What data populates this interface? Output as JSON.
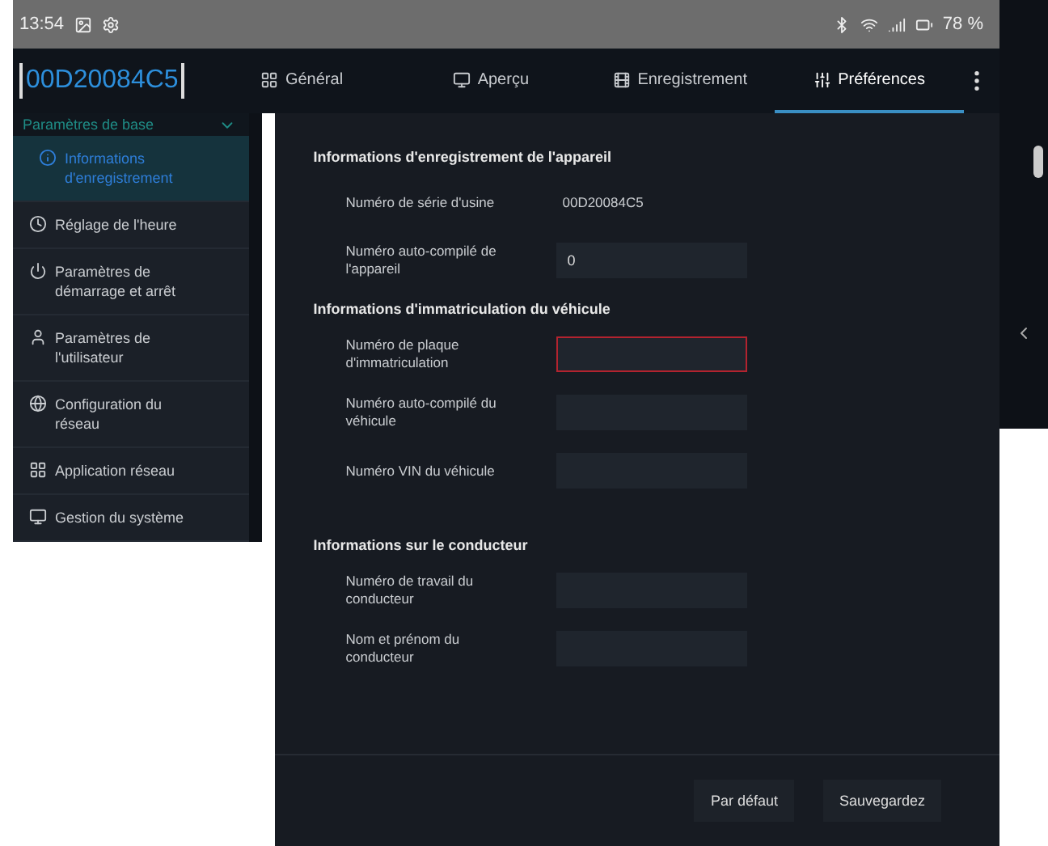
{
  "status_bar": {
    "time": "13:54",
    "battery": "78 %"
  },
  "header": {
    "device_id": "00D20084C5",
    "tabs": [
      {
        "label": "Général",
        "selected": false
      },
      {
        "label": "Aperçu",
        "selected": false
      },
      {
        "label": "Enregistrement",
        "selected": false
      },
      {
        "label": "Préférences",
        "selected": true
      }
    ]
  },
  "sidebar": {
    "group": "Paramètres de base",
    "expanded": true,
    "items": [
      {
        "label": "Informations d'enregistrement",
        "selected": true
      },
      {
        "label": "Réglage de l'heure",
        "selected": false
      },
      {
        "label": "Paramètres de démarrage et arrêt",
        "selected": false
      },
      {
        "label": "Paramètres de l'utilisateur",
        "selected": false
      },
      {
        "label": "Configuration du réseau",
        "selected": false
      },
      {
        "label": "Application réseau",
        "selected": false
      },
      {
        "label": "Gestion du système",
        "selected": false
      }
    ]
  },
  "sections": [
    {
      "title": "Informations d'enregistrement de l'appareil",
      "rows": [
        {
          "kind": "text",
          "label": "Numéro de série d'usine",
          "value": "00D20084C5"
        },
        {
          "kind": "field",
          "label": "Numéro auto-compilé de l'appareil",
          "value": "0",
          "error": false
        }
      ]
    },
    {
      "title": "Informations d'immatriculation du véhicule",
      "rows": [
        {
          "kind": "field",
          "label": "Numéro de plaque d'immatriculation",
          "value": "",
          "error": true
        },
        {
          "kind": "field",
          "label": "Numéro auto-compilé du véhicule",
          "value": "",
          "error": false
        },
        {
          "kind": "field",
          "label": "Numéro VIN du véhicule",
          "value": "",
          "error": false
        }
      ]
    },
    {
      "title": "Informations sur le conducteur",
      "rows": [
        {
          "kind": "field",
          "label": "Numéro de travail du conducteur",
          "value": "",
          "error": false
        },
        {
          "kind": "field",
          "label": "Nom et prénom du conducteur",
          "value": "",
          "error": false
        }
      ]
    }
  ],
  "buttons": [
    "Par défaut",
    "Sauvegardez"
  ]
}
